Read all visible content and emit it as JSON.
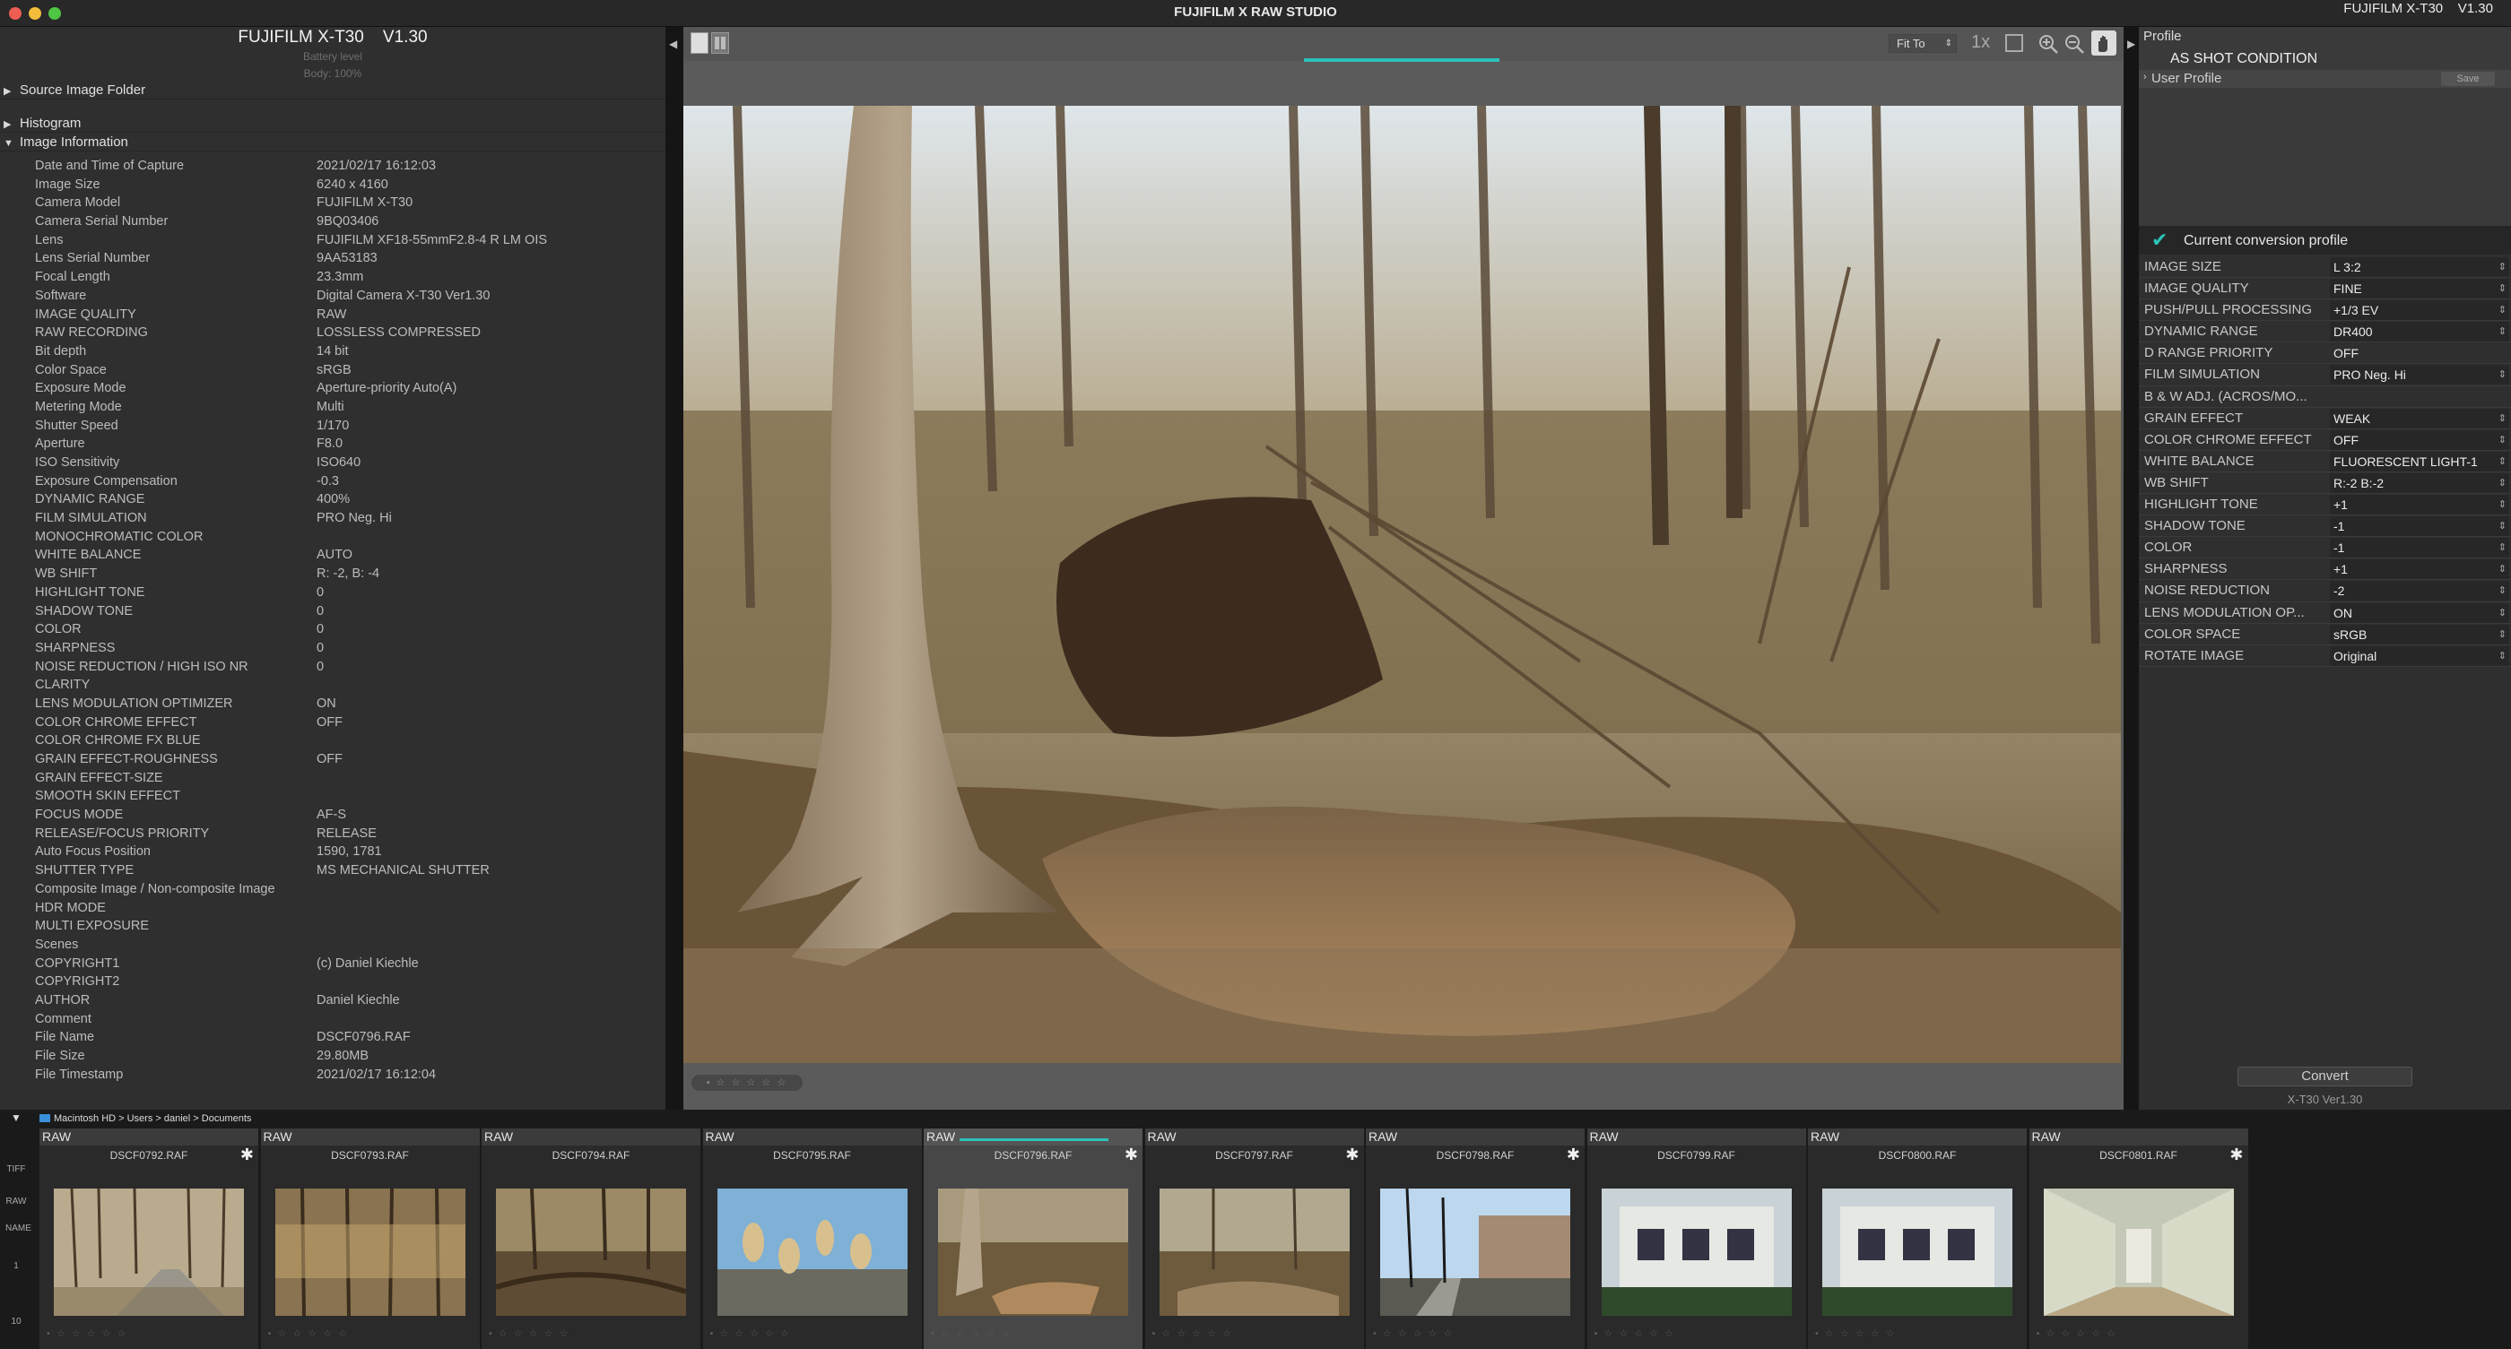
{
  "window": {
    "app_title": "FUJIFILM X RAW STUDIO",
    "camera_top_right": "FUJIFILM X-T30    V1.30"
  },
  "left_panel": {
    "camera_name": "FUJIFILM X-T30    V1.30",
    "battery_label": "Battery level",
    "body_label": "Body: 100%",
    "sections": {
      "source_folder": "Source Image Folder",
      "histogram": "Histogram",
      "image_information": "Image Information"
    },
    "info": [
      {
        "label": "Date and Time of Capture",
        "value": "2021/02/17 16:12:03"
      },
      {
        "label": "Image Size",
        "value": "6240 x 4160"
      },
      {
        "label": "Camera Model",
        "value": "FUJIFILM X-T30"
      },
      {
        "label": "Camera Serial Number",
        "value": "9BQ03406"
      },
      {
        "label": "Lens",
        "value": "FUJIFILM XF18-55mmF2.8-4 R LM OIS"
      },
      {
        "label": "Lens Serial Number",
        "value": "9AA53183"
      },
      {
        "label": "Focal Length",
        "value": "23.3mm"
      },
      {
        "label": "Software",
        "value": "Digital Camera X-T30 Ver1.30"
      },
      {
        "label": "IMAGE QUALITY",
        "value": "RAW"
      },
      {
        "label": "RAW RECORDING",
        "value": "LOSSLESS COMPRESSED"
      },
      {
        "label": "Bit depth",
        "value": "14 bit"
      },
      {
        "label": "Color Space",
        "value": "sRGB"
      },
      {
        "label": "Exposure Mode",
        "value": "Aperture-priority Auto(A)"
      },
      {
        "label": "Metering Mode",
        "value": "Multi"
      },
      {
        "label": "Shutter Speed",
        "value": "1/170"
      },
      {
        "label": "Aperture",
        "value": "F8.0"
      },
      {
        "label": "ISO Sensitivity",
        "value": "ISO640"
      },
      {
        "label": "Exposure Compensation",
        "value": "-0.3"
      },
      {
        "label": "DYNAMIC RANGE",
        "value": "400%"
      },
      {
        "label": "FILM SIMULATION",
        "value": "PRO Neg. Hi"
      },
      {
        "label": "MONOCHROMATIC COLOR",
        "value": ""
      },
      {
        "label": "WHITE BALANCE",
        "value": "AUTO"
      },
      {
        "label": "WB SHIFT",
        "value": "R: -2, B: -4"
      },
      {
        "label": "HIGHLIGHT TONE",
        "value": "0"
      },
      {
        "label": "SHADOW TONE",
        "value": "0"
      },
      {
        "label": "COLOR",
        "value": "0"
      },
      {
        "label": "SHARPNESS",
        "value": "0"
      },
      {
        "label": "NOISE REDUCTION / HIGH ISO NR",
        "value": "0"
      },
      {
        "label": "CLARITY",
        "value": ""
      },
      {
        "label": "LENS MODULATION OPTIMIZER",
        "value": "ON"
      },
      {
        "label": "COLOR CHROME EFFECT",
        "value": "OFF"
      },
      {
        "label": "COLOR CHROME FX BLUE",
        "value": ""
      },
      {
        "label": "GRAIN EFFECT-ROUGHNESS",
        "value": "OFF"
      },
      {
        "label": "GRAIN EFFECT-SIZE",
        "value": ""
      },
      {
        "label": "SMOOTH SKIN EFFECT",
        "value": ""
      },
      {
        "label": "FOCUS MODE",
        "value": "AF-S"
      },
      {
        "label": "RELEASE/FOCUS PRIORITY",
        "value": "RELEASE"
      },
      {
        "label": "Auto Focus Position",
        "value": "1590, 1781"
      },
      {
        "label": "SHUTTER TYPE",
        "value": "MS MECHANICAL SHUTTER"
      },
      {
        "label": "Composite Image / Non-composite Image",
        "value": ""
      },
      {
        "label": "HDR MODE",
        "value": ""
      },
      {
        "label": "MULTI EXPOSURE",
        "value": ""
      },
      {
        "label": "Scenes",
        "value": ""
      },
      {
        "label": "COPYRIGHT1",
        "value": "(c) Daniel Kiechle"
      },
      {
        "label": "COPYRIGHT2",
        "value": ""
      },
      {
        "label": "AUTHOR",
        "value": "Daniel Kiechle"
      },
      {
        "label": "Comment",
        "value": ""
      },
      {
        "label": "File Name",
        "value": "DSCF0796.RAF"
      },
      {
        "label": "File Size",
        "value": "29.80MB"
      },
      {
        "label": "File Timestamp",
        "value": "2021/02/17 16:12:04"
      }
    ]
  },
  "toolbar": {
    "fit_select": "Fit To",
    "zoom_1x": "1x"
  },
  "right_panel": {
    "profile_title": "Profile",
    "as_shot": "AS SHOT CONDITION",
    "user_profile": "User Profile",
    "save_label": "Save",
    "current_profile_label": "Current conversion profile",
    "settings": [
      {
        "label": "IMAGE SIZE",
        "value": "L 3:2",
        "control": true
      },
      {
        "label": "IMAGE QUALITY",
        "value": "FINE",
        "control": true
      },
      {
        "label": "PUSH/PULL PROCESSING",
        "value": "+1/3 EV",
        "control": true
      },
      {
        "label": "DYNAMIC RANGE",
        "value": "DR400",
        "control": true
      },
      {
        "label": "D RANGE PRIORITY",
        "value": "OFF",
        "control": false
      },
      {
        "label": "FILM SIMULATION",
        "value": "PRO Neg. Hi",
        "control": true
      },
      {
        "label": "B & W ADJ. (ACROS/MO...",
        "value": "",
        "control": false
      },
      {
        "label": "GRAIN EFFECT",
        "value": "WEAK",
        "control": true
      },
      {
        "label": "COLOR CHROME EFFECT",
        "value": "OFF",
        "control": true
      },
      {
        "label": "WHITE BALANCE",
        "value": "FLUORESCENT LIGHT-1",
        "control": true
      },
      {
        "label": "WB SHIFT",
        "value": "R:-2 B:-2",
        "control": true
      },
      {
        "label": "HIGHLIGHT TONE",
        "value": "+1",
        "control": true
      },
      {
        "label": "SHADOW TONE",
        "value": "-1",
        "control": true
      },
      {
        "label": "COLOR",
        "value": "-1",
        "control": true
      },
      {
        "label": "SHARPNESS",
        "value": "+1",
        "control": true
      },
      {
        "label": "NOISE REDUCTION",
        "value": "-2",
        "control": true
      },
      {
        "label": "LENS MODULATION OP...",
        "value": "ON",
        "control": true
      },
      {
        "label": "COLOR SPACE",
        "value": "sRGB",
        "control": true
      },
      {
        "label": "ROTATE IMAGE",
        "value": "Original",
        "control": true
      }
    ],
    "convert_label": "Convert",
    "convert_sub": "X-T30 Ver1.30"
  },
  "bottom": {
    "breadcrumb": "Macintosh HD > Users > daniel > Documents",
    "side_tools": [
      "TIFF",
      "RAW",
      "NAME",
      "1",
      "10"
    ],
    "thumbnails": [
      {
        "tag": "RAW",
        "name": "DSCF0792.RAF",
        "marked": true,
        "active": false,
        "scene": "trail"
      },
      {
        "tag": "RAW",
        "name": "DSCF0793.RAF",
        "marked": false,
        "active": false,
        "scene": "forest"
      },
      {
        "tag": "RAW",
        "name": "DSCF0794.RAF",
        "marked": false,
        "active": false,
        "scene": "forest2"
      },
      {
        "tag": "RAW",
        "name": "DSCF0795.RAF",
        "marked": false,
        "active": false,
        "scene": "leaves"
      },
      {
        "tag": "RAW",
        "name": "DSCF0796.RAF",
        "marked": true,
        "active": true,
        "scene": "creek"
      },
      {
        "tag": "RAW",
        "name": "DSCF0797.RAF",
        "marked": true,
        "active": false,
        "scene": "creek2"
      },
      {
        "tag": "RAW",
        "name": "DSCF0798.RAF",
        "marked": true,
        "active": false,
        "scene": "street"
      },
      {
        "tag": "RAW",
        "name": "DSCF0799.RAF",
        "marked": false,
        "active": false,
        "scene": "house"
      },
      {
        "tag": "RAW",
        "name": "DSCF0800.RAF",
        "marked": false,
        "active": false,
        "scene": "house"
      },
      {
        "tag": "RAW",
        "name": "DSCF0801.RAF",
        "marked": true,
        "active": false,
        "scene": "hallway"
      }
    ]
  },
  "colors": {
    "accent_teal": "#2bc2b8",
    "panel_bg": "#2f2f2f",
    "viewer_bg": "#5b5b5b"
  }
}
